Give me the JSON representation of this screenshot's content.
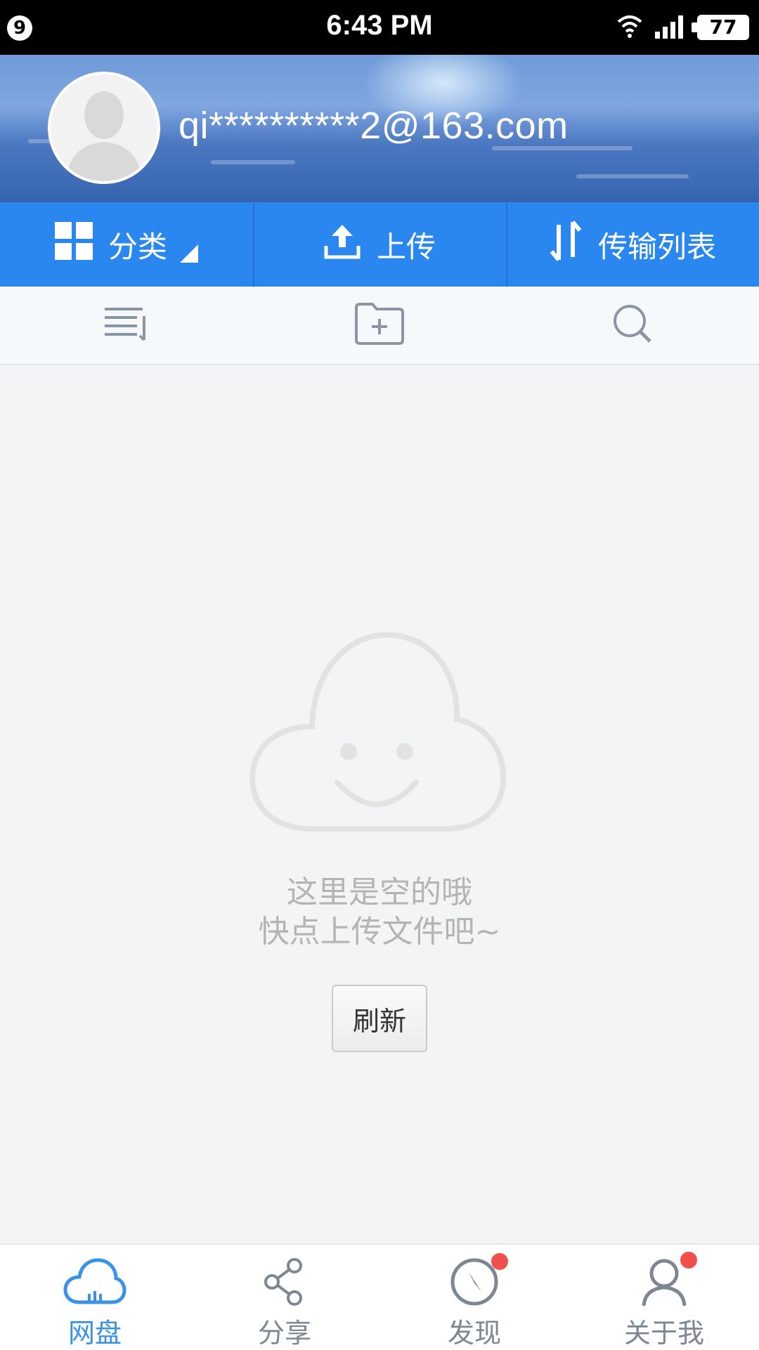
{
  "status_bar": {
    "notification_count": "9",
    "time": "6:43 PM",
    "battery": "77"
  },
  "profile": {
    "email": "qi**********2@163.com"
  },
  "action_bar": {
    "category_label": "分类",
    "upload_label": "上传",
    "transfer_label": "传输列表"
  },
  "toolbar": {
    "icons": [
      "sort-list-icon",
      "new-folder-icon",
      "search-icon"
    ]
  },
  "empty_state": {
    "line1": "这里是空的哦",
    "line2": "快点上传文件吧~",
    "refresh_label": "刷新"
  },
  "bottom_nav": {
    "items": [
      {
        "label": "网盘",
        "icon": "cloud-drive-icon",
        "active": true
      },
      {
        "label": "分享",
        "icon": "share-icon",
        "badge": false
      },
      {
        "label": "发现",
        "icon": "compass-icon",
        "badge": true
      },
      {
        "label": "关于我",
        "icon": "user-icon",
        "badge": true
      }
    ]
  },
  "colors": {
    "accent": "#2a87ef",
    "active_tab": "#3a92e8",
    "badge": "#f0504b"
  }
}
